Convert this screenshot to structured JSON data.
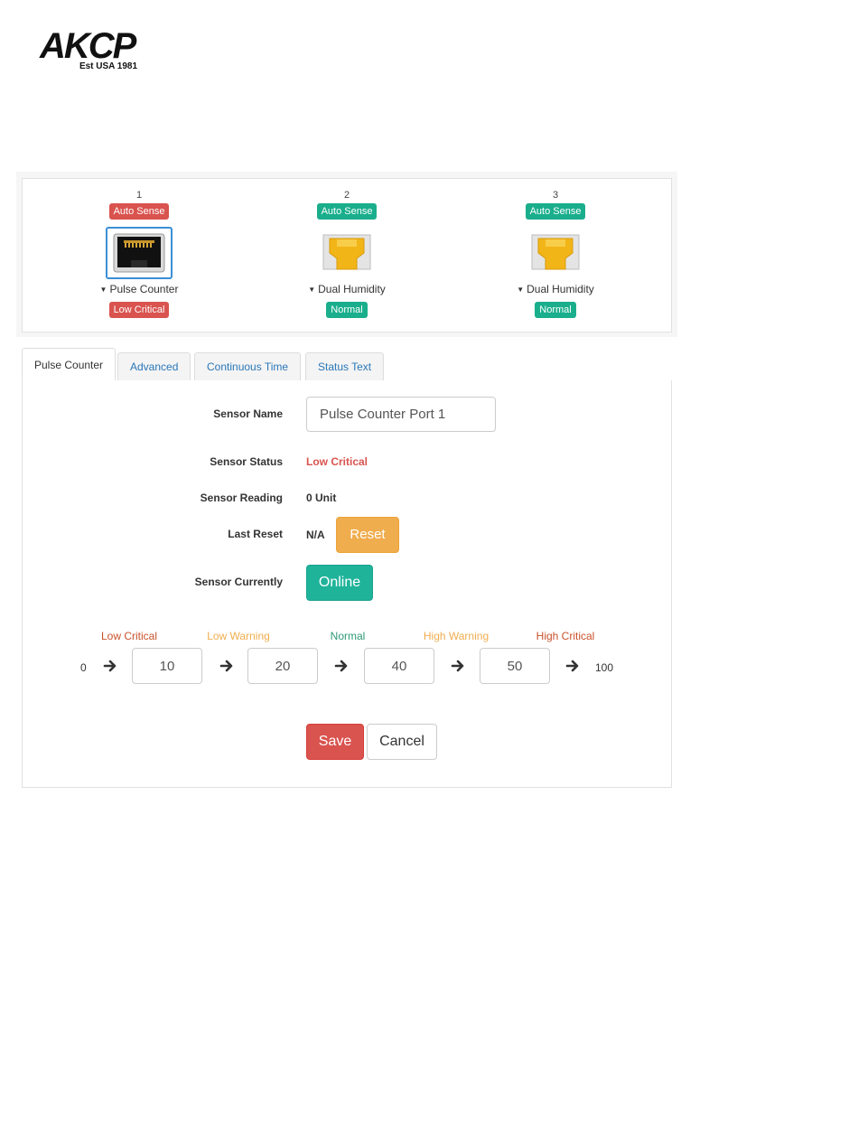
{
  "logo": {
    "text": "AKCP",
    "tagline": "Est USA 1981"
  },
  "ports": [
    {
      "number": "1",
      "mode": "Auto Sense",
      "type": "Pulse Counter",
      "status": "Low Critical",
      "color": "#d9534f",
      "icon": "ethernet-port-icon",
      "selected": true
    },
    {
      "number": "2",
      "mode": "Auto Sense",
      "type": "Dual Humidity",
      "status": "Normal",
      "color": "#1aae8c",
      "icon": "sensor-plug-icon",
      "selected": false
    },
    {
      "number": "3",
      "mode": "Auto Sense",
      "type": "Dual Humidity",
      "status": "Normal",
      "color": "#1aae8c",
      "icon": "sensor-plug-icon",
      "selected": false
    }
  ],
  "tabs": [
    "Pulse Counter",
    "Advanced",
    "Continuous Time",
    "Status Text"
  ],
  "active_tab": "Pulse Counter",
  "form": {
    "sensor_name_label": "Sensor Name",
    "sensor_name_value": "Pulse Counter Port 1",
    "sensor_status_label": "Sensor Status",
    "sensor_status_value": "Low Critical",
    "sensor_reading_label": "Sensor Reading",
    "sensor_reading_value": "0 Unit",
    "last_reset_label": "Last Reset",
    "last_reset_value": "N/A",
    "reset_button": "Reset",
    "sensor_currently_label": "Sensor Currently",
    "online_button": "Online"
  },
  "thresholds": {
    "labels": [
      {
        "text": "Low Critical",
        "color": "#c9512a"
      },
      {
        "text": "Low Warning",
        "color": "#f0ad4e"
      },
      {
        "text": "Normal",
        "color": "#2e9a78"
      },
      {
        "text": "High Warning",
        "color": "#f0ad4e"
      },
      {
        "text": "High Critical",
        "color": "#c9512a"
      }
    ],
    "min": "0",
    "values": [
      "10",
      "20",
      "40",
      "50"
    ],
    "max": "100"
  },
  "actions": {
    "save": "Save",
    "cancel": "Cancel"
  },
  "colors": {
    "danger": "#d9534f",
    "success": "#1aae8c",
    "warning": "#f0ad4e",
    "link": "#2a77b8"
  }
}
